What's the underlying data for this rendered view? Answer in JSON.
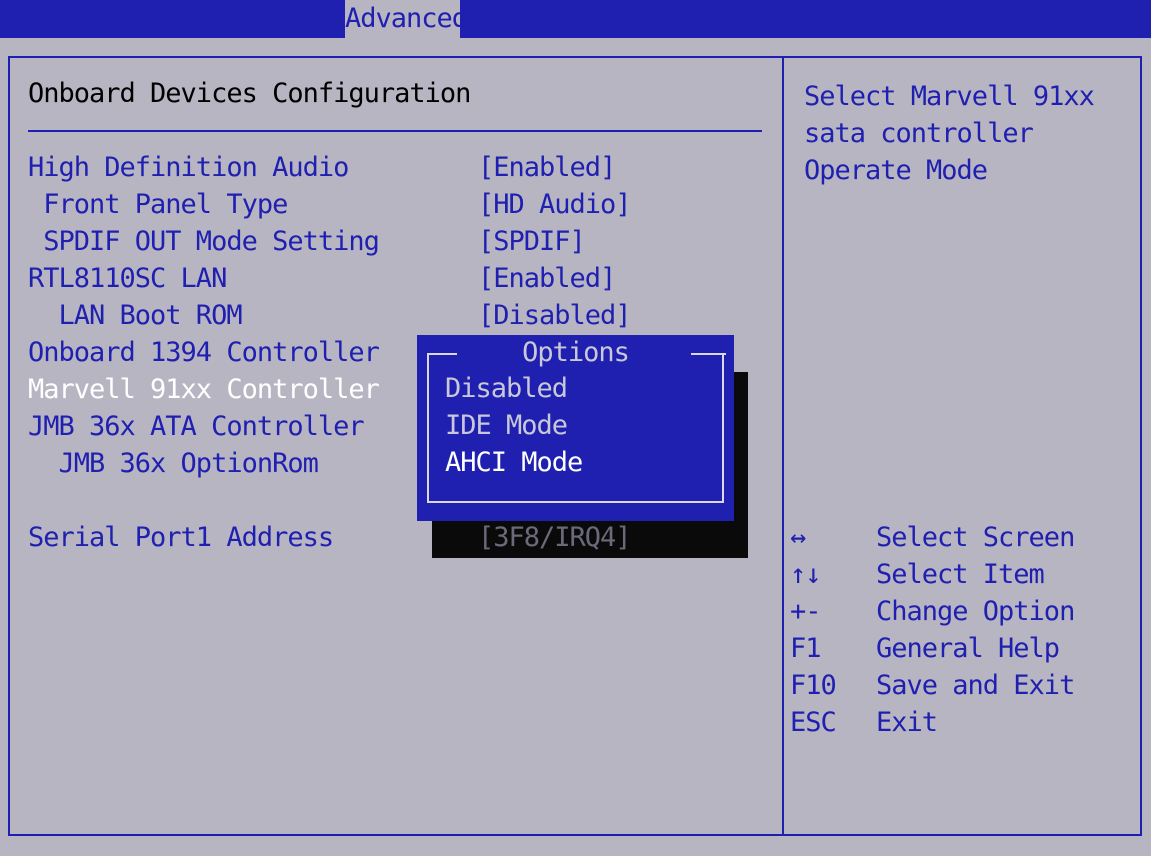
{
  "header": {
    "active_tab": "Advanced"
  },
  "page": {
    "title": "Onboard Devices Configuration"
  },
  "settings": [
    {
      "label": "High Definition Audio",
      "value": "[Enabled]"
    },
    {
      "label": " Front Panel Type",
      "value": "[HD Audio]"
    },
    {
      "label": " SPDIF OUT Mode Setting",
      "value": "[SPDIF]"
    },
    {
      "label": "RTL8110SC LAN",
      "value": "[Enabled]"
    },
    {
      "label": "  LAN Boot ROM",
      "value": "[Disabled]"
    },
    {
      "label": "Onboard 1394 Controller",
      "value": ""
    },
    {
      "label": "Marvell 91xx Controller",
      "value": ""
    },
    {
      "label": "JMB 36x ATA Controller",
      "value": ""
    },
    {
      "label": "  JMB 36x OptionRom",
      "value": ""
    },
    {
      "label": "Serial Port1 Address",
      "value": "[3F8/IRQ4]"
    }
  ],
  "help_text": [
    "Select Marvell 91xx",
    "sata controller",
    "Operate Mode"
  ],
  "keys": [
    {
      "key": "↔",
      "desc": "Select Screen"
    },
    {
      "key": "↑↓",
      "desc": "Select Item"
    },
    {
      "key": "+-",
      "desc": "Change Option"
    },
    {
      "key": "F1",
      "desc": "General Help"
    },
    {
      "key": "F10",
      "desc": "Save and Exit"
    },
    {
      "key": "ESC",
      "desc": "Exit"
    }
  ],
  "options_popup": {
    "title": "Options",
    "items": [
      "Disabled",
      "IDE Mode",
      "AHCI Mode"
    ],
    "selected": "AHCI Mode"
  },
  "colors": {
    "background": "#b8b5c3",
    "accent": "#1f1fb0",
    "highlight": "#ffffff"
  }
}
